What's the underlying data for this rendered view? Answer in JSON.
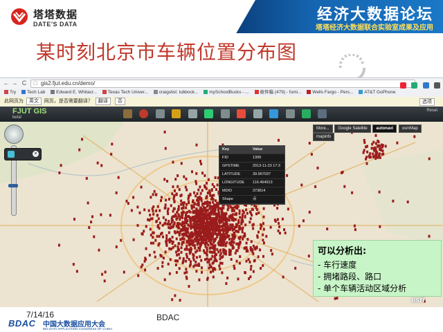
{
  "header": {
    "logo_cn": "塔塔数据",
    "logo_en": "DATE'S DATA",
    "banner_title": "经济大数据论坛",
    "banner_sub": "塔塔经济大数据联合实验室成果及应用"
  },
  "slide_title": "某时刻北京市车辆位置分布图",
  "browser": {
    "url": "gis2.fjut.edu.cn/demo/",
    "back": "←",
    "forward": "→",
    "reload": "C",
    "bookmarks": [
      "Try",
      "Tech Lab",
      "Edward E. Whitacr...",
      "Texas Tech Univer...",
      "craigslist: lubbock...",
      "mySchoolBucks - ...",
      "收件箱 (479) - fumi...",
      "Wells Fargo - Pers...",
      "AT&T GoPhone"
    ],
    "translate": {
      "prefix": "此网页为",
      "lang": "英文",
      "question": "网页，是否需要翻译？",
      "translate_btn": "翻译",
      "no_btn": "否",
      "options": "选项"
    }
  },
  "gis": {
    "title": "FJUT GIS",
    "beta": "beta!",
    "reset": "Reset",
    "basemaps": [
      "More...",
      "Google Satellite",
      "autonavi",
      "osmMap",
      "mapinfo"
    ],
    "active_basemap": "autonavi",
    "zoom_level": 0.56,
    "popup": {
      "header": [
        "Key",
        "Value"
      ],
      "rows": [
        [
          "FID",
          "1399"
        ],
        [
          "GPSTIME",
          "2013-11-23 17:3"
        ],
        [
          "LATITUDE",
          "39.967037"
        ],
        [
          "LONGITUDE",
          "116.464913"
        ],
        [
          "MDID",
          "373814"
        ],
        [
          "Shape",
          "点"
        ]
      ]
    },
    "esri": "esri"
  },
  "analysis": {
    "heading": "可以分析出:",
    "items": [
      "- 车行速度",
      "- 拥堵路段、路口",
      "- 单个车辆活动区域分析"
    ]
  },
  "footer": {
    "date": "7/14/16",
    "center": "BDAC",
    "logo": "BDAC",
    "conf_cn": "中国大数据应用大会",
    "conf_en": "BIG DATA APPLICATION CONGRESS OF CHINA"
  },
  "colors": {
    "title_red": "#c0392b",
    "banner_blue": "#1565b0",
    "marker": "#9b1c1c",
    "panel_green": "#c8f5c8"
  }
}
